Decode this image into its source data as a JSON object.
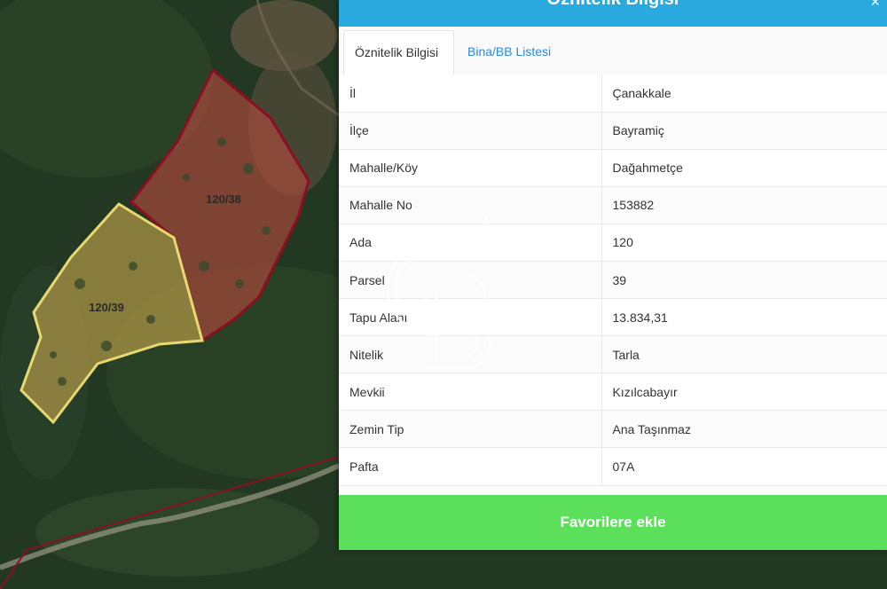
{
  "panel": {
    "title": "Öznitelik Bilgisi",
    "close_glyph": "×"
  },
  "tabs": [
    {
      "label": "Öznitelik Bilgisi",
      "active": true
    },
    {
      "label": "Bina/BB Listesi",
      "active": false
    }
  ],
  "attributes": [
    {
      "key": "İl",
      "value": "Çanakkale"
    },
    {
      "key": "İlçe",
      "value": "Bayramiç"
    },
    {
      "key": "Mahalle/Köy",
      "value": "Dağahmetçe"
    },
    {
      "key": "Mahalle No",
      "value": "153882"
    },
    {
      "key": "Ada",
      "value": "120"
    },
    {
      "key": "Parsel",
      "value": "39"
    },
    {
      "key": "Tapu Alanı",
      "value": "13.834,31"
    },
    {
      "key": "Nitelik",
      "value": "Tarla"
    },
    {
      "key": "Mevkii",
      "value": "Kızılcabayır"
    },
    {
      "key": "Zemin Tip",
      "value": "Ana Taşınmaz"
    },
    {
      "key": "Pafta",
      "value": "07A"
    }
  ],
  "favorite_button_label": "Favorilere ekle",
  "map": {
    "parcels": [
      {
        "label": "120/38",
        "fill": "#b04a3c",
        "stroke": "#8a1020"
      },
      {
        "label": "120/39",
        "fill": "#b49a48",
        "stroke": "#e8d870"
      }
    ]
  },
  "colors": {
    "header": "#2aa9de",
    "tab_link": "#2a8bd9",
    "button": "#5ce05c"
  },
  "icons": {
    "menu": "vertical-dots-icon",
    "close": "close-icon",
    "watermark": "cb-logo"
  }
}
